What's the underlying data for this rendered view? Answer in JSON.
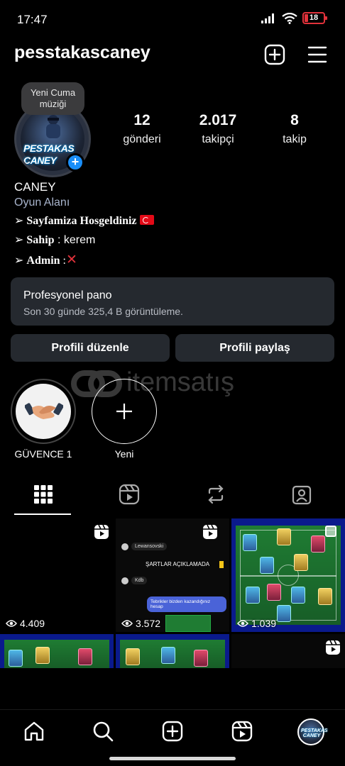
{
  "status_bar": {
    "time": "17:47",
    "battery": "18"
  },
  "header": {
    "username": "pesstakascaney"
  },
  "profile": {
    "note": "Yeni Cuma müziği",
    "avatar_text": "PESTAKAS CANEY",
    "stats": [
      {
        "value": "12",
        "label": "gönderi"
      },
      {
        "value": "2.017",
        "label": "takipçi"
      },
      {
        "value": "8",
        "label": "takip"
      }
    ],
    "name": "CANEY",
    "category": "Oyun Alanı",
    "bio": [
      {
        "arrow": "➢",
        "bold": "Sayfamiza Hosgeldiniz",
        "rest": ""
      },
      {
        "arrow": "➢",
        "bold": "Sahip",
        "rest": " : kerem"
      },
      {
        "arrow": "➢",
        "bold": "Admin",
        "rest": " :"
      }
    ]
  },
  "dashboard": {
    "title": "Profesyonel pano",
    "subtitle": "Son 30 günde 325,4 B görüntüleme."
  },
  "buttons": {
    "edit": "Profili düzenle",
    "share": "Profili paylaş"
  },
  "watermark": "itemsatış",
  "highlights": [
    {
      "label": "GÜVENCE 1"
    },
    {
      "label": "Yeni"
    }
  ],
  "posts": [
    {
      "views": "4.409"
    },
    {
      "views": "3.572",
      "chat": [
        "Lewansovski",
        "ŞARTLAR AÇIKLAMADA",
        "Kdb",
        "Tebrikler bizden kazandığınız hesap"
      ]
    },
    {
      "views": "1.039"
    }
  ]
}
